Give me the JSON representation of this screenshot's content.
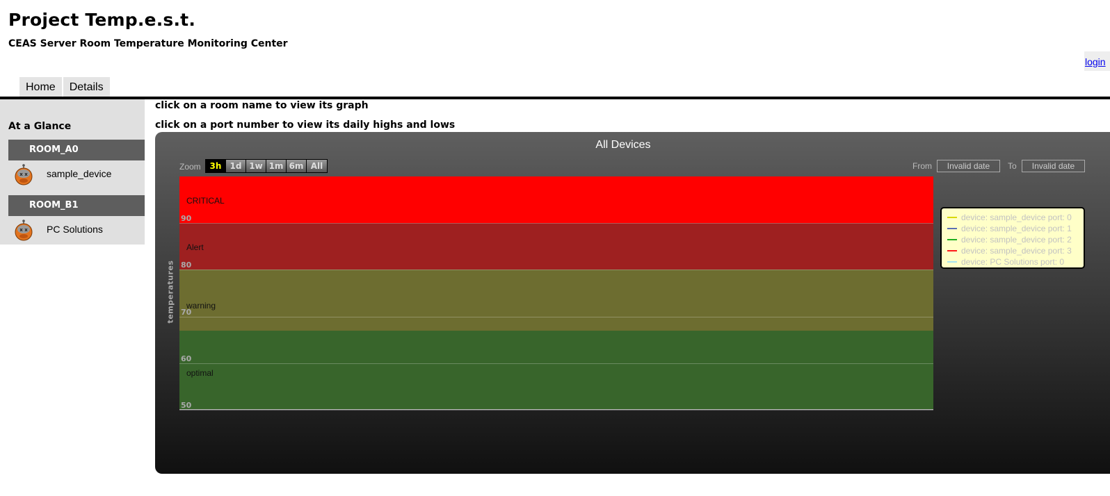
{
  "header": {
    "title": "Project Temp.e.s.t.",
    "subtitle": "CEAS Server Room Temperature Monitoring Center",
    "login_label": "login"
  },
  "nav": {
    "tabs": [
      {
        "label": "Home"
      },
      {
        "label": "Details"
      }
    ]
  },
  "sidebar": {
    "title": "At a Glance",
    "rooms": [
      {
        "name": "ROOM_A0",
        "device": "sample_device"
      },
      {
        "name": "ROOM_B1",
        "device": "PC Solutions"
      }
    ]
  },
  "hints": {
    "line1": "click on a room name to view its graph",
    "line2": "click on a port number to view its daily highs and lows"
  },
  "chart": {
    "zoom_label": "Zoom",
    "zoom_options": [
      "3h",
      "1d",
      "1w",
      "1m",
      "6m",
      "All"
    ],
    "zoom_selected": "3h",
    "from_label": "From",
    "from_value": "Invalid date",
    "to_label": "To",
    "to_value": "Invalid date"
  },
  "colors": {
    "critical": "#ff0000",
    "alert": "#9e2020",
    "warning": "#6d6d30",
    "optimal": "#38652b",
    "legend_bg": "#ffffc8"
  },
  "chart_data": {
    "type": "line",
    "title": "All Devices",
    "ylabel": "temperatures",
    "ylim": [
      50,
      100
    ],
    "yticks": [
      50,
      60,
      70,
      80,
      90
    ],
    "grid": true,
    "legend_placement": "right",
    "bands": [
      {
        "label": "CRITICAL",
        "from": 90,
        "to": 100,
        "color": "#ff0000"
      },
      {
        "label": "Alert",
        "from": 80,
        "to": 90,
        "color": "#9e2020"
      },
      {
        "label": "warning",
        "from": 67,
        "to": 80,
        "color": "#6d6d30"
      },
      {
        "label": "optimal",
        "from": 50,
        "to": 67,
        "color": "#38652b"
      }
    ],
    "band_label_values": [
      95,
      85,
      72.5,
      58
    ],
    "series": [
      {
        "name": "device: sample_device port: 0",
        "color": "#d8d800",
        "values": []
      },
      {
        "name": "device: sample_device port: 1",
        "color": "#5b6fb2",
        "values": []
      },
      {
        "name": "device: sample_device port: 2",
        "color": "#1fae1f",
        "values": []
      },
      {
        "name": "device: sample_device port: 3",
        "color": "#ff1a1a",
        "values": []
      },
      {
        "name": "device: PC Solutions port: 0",
        "color": "#a6e3f0",
        "values": []
      }
    ]
  }
}
